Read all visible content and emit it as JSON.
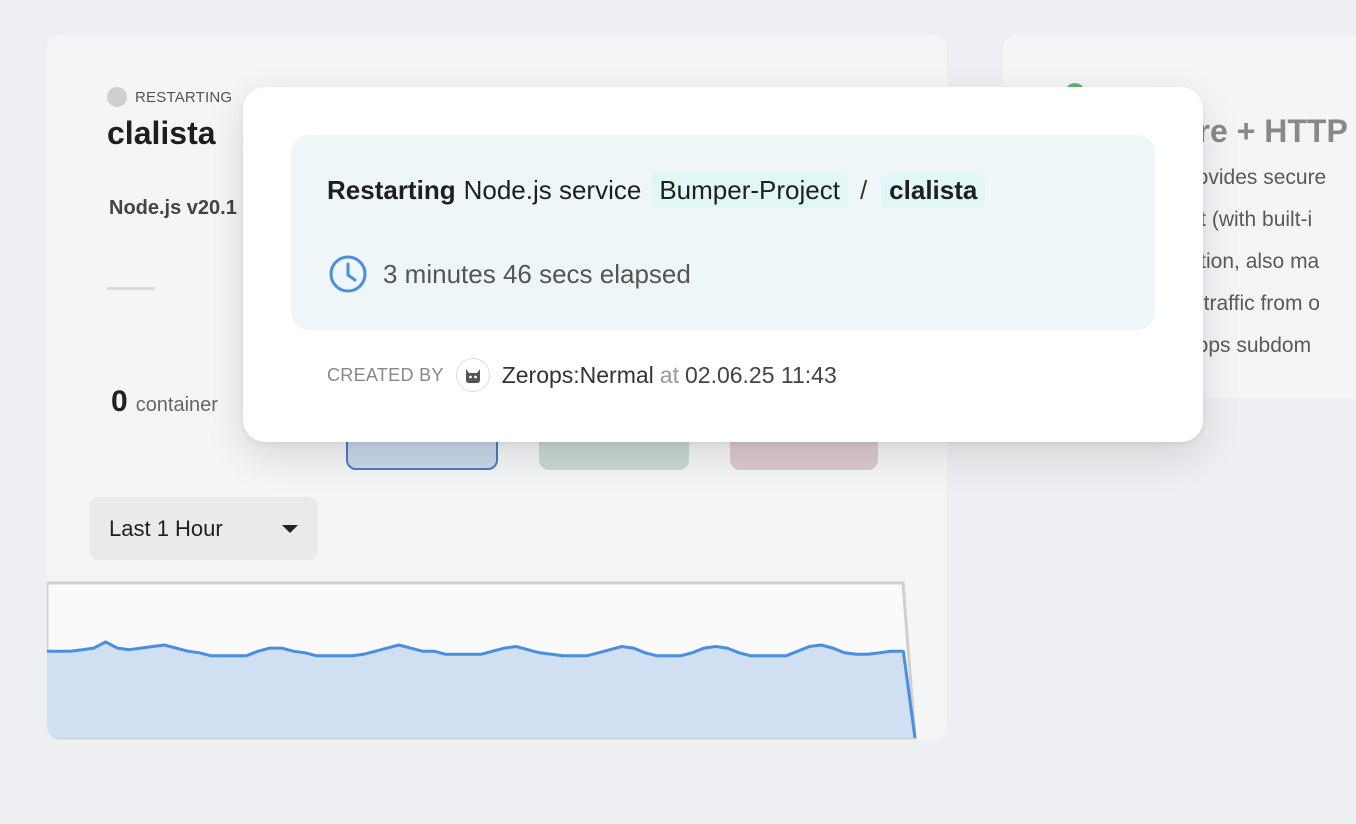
{
  "left_card": {
    "status": "RESTARTING",
    "name": "clalista",
    "version": "Node.js v20.1",
    "container_count": "0",
    "container_label": "container",
    "time_range": "Last 1 Hour"
  },
  "right_card": {
    "title": "ore + HTTP",
    "description_lines": [
      "provides secure",
      "ect (with built-i",
      "ection, also ma",
      "/S traffic from o",
      "erops subdom"
    ]
  },
  "modal": {
    "action": "Restarting",
    "service_type": "Node.js service",
    "project": "Bumper-Project",
    "separator": "/",
    "service": "clalista",
    "elapsed": "3 minutes 46 secs elapsed",
    "created_by_label": "CREATED BY",
    "creator": "Zerops:Nermal",
    "at_word": "at",
    "created_at": "02.06.25 11:43"
  },
  "colors": {
    "accent": "#4a8ee0",
    "chip_bg": "#e0f7f5",
    "panel_bg": "#eef6f9",
    "status_restarting": "#cfcfcf",
    "status_active": "#5bb86a"
  },
  "chart_data": {
    "type": "area",
    "values": [
      56,
      56,
      56,
      57,
      58,
      62,
      58,
      57,
      58,
      59,
      60,
      58,
      56,
      55,
      53,
      53,
      53,
      53,
      56,
      58,
      58,
      56,
      55,
      53,
      53,
      53,
      53,
      54,
      56,
      58,
      60,
      58,
      56,
      56,
      54,
      54,
      54,
      54,
      56,
      58,
      59,
      57,
      55,
      54,
      53,
      53,
      53,
      55,
      57,
      59,
      58,
      55,
      53,
      53,
      53,
      55,
      58,
      59,
      58,
      55,
      53,
      53,
      53,
      53,
      56,
      59,
      60,
      58,
      55,
      54,
      54,
      55,
      56,
      56,
      0
    ],
    "ylim": [
      0,
      100
    ]
  }
}
